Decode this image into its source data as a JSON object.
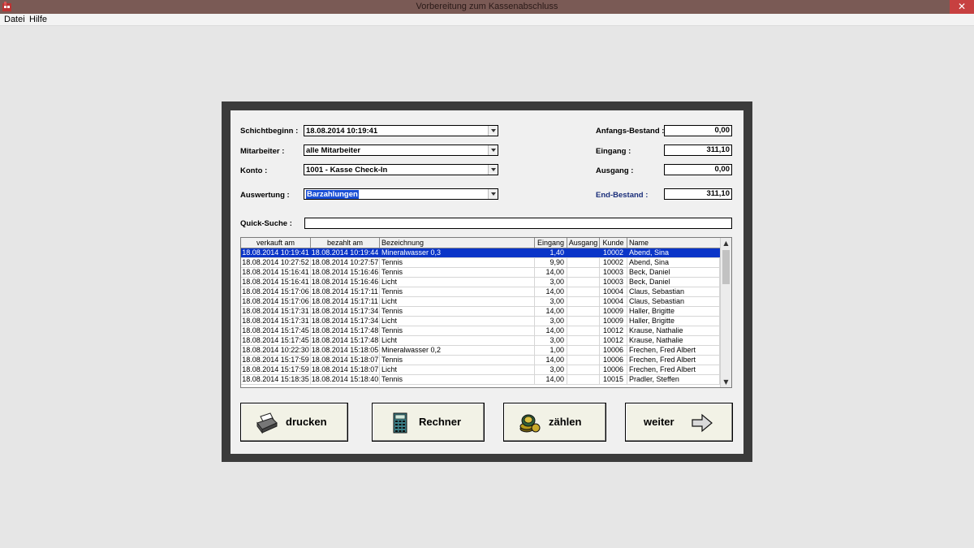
{
  "window": {
    "title": "Vorbereitung zum Kassenabschluss",
    "close_label": "✕"
  },
  "menu": [
    "Datei",
    "Hilfe"
  ],
  "form": {
    "schichtbeginn_label": "Schichtbeginn :",
    "schichtbeginn_value": "18.08.2014 10:19:41",
    "mitarbeiter_label": "Mitarbeiter :",
    "mitarbeiter_value": "alle Mitarbeiter",
    "konto_label": "Konto :",
    "konto_value": "1001 - Kasse Check-In",
    "auswertung_label": "Auswertung :",
    "auswertung_value": "Barzahlungen",
    "quick_label": "Quick-Suche :",
    "quick_value": ""
  },
  "totals": {
    "anfangs_label": "Anfangs-Bestand :",
    "anfangs_value": "0,00",
    "eingang_label": "Eingang :",
    "eingang_value": "311,10",
    "ausgang_label": "Ausgang :",
    "ausgang_value": "0,00",
    "end_label": "End-Bestand :",
    "end_value": "311,10",
    "end_label_color": "#1a2e7a"
  },
  "table": {
    "headers": [
      "verkauft am",
      "bezahlt am",
      "Bezeichnung",
      "Eingang",
      "Ausgang",
      "Kunde",
      "Name"
    ],
    "rows": [
      [
        "18.08.2014 10:19:41",
        "18.08.2014 10:19:44",
        "Mineralwasser 0,3",
        "1,40",
        "",
        "10002",
        "Abend, Sina"
      ],
      [
        "18.08.2014 10:27:52",
        "18.08.2014 10:27:57",
        "Tennis",
        "9,90",
        "",
        "10002",
        "Abend, Sina"
      ],
      [
        "18.08.2014 15:16:41",
        "18.08.2014 15:16:46",
        "Tennis",
        "14,00",
        "",
        "10003",
        "Beck, Daniel"
      ],
      [
        "18.08.2014 15:16:41",
        "18.08.2014 15:16:46",
        "Licht",
        "3,00",
        "",
        "10003",
        "Beck, Daniel"
      ],
      [
        "18.08.2014 15:17:06",
        "18.08.2014 15:17:11",
        "Tennis",
        "14,00",
        "",
        "10004",
        "Claus, Sebastian"
      ],
      [
        "18.08.2014 15:17:06",
        "18.08.2014 15:17:11",
        "Licht",
        "3,00",
        "",
        "10004",
        "Claus, Sebastian"
      ],
      [
        "18.08.2014 15:17:31",
        "18.08.2014 15:17:34",
        "Tennis",
        "14,00",
        "",
        "10009",
        "Haller, Brigitte"
      ],
      [
        "18.08.2014 15:17:31",
        "18.08.2014 15:17:34",
        "Licht",
        "3,00",
        "",
        "10009",
        "Haller, Brigitte"
      ],
      [
        "18.08.2014 15:17:45",
        "18.08.2014 15:17:48",
        "Tennis",
        "14,00",
        "",
        "10012",
        "Krause, Nathalie"
      ],
      [
        "18.08.2014 15:17:45",
        "18.08.2014 15:17:48",
        "Licht",
        "3,00",
        "",
        "10012",
        "Krause, Nathalie"
      ],
      [
        "18.08.2014 10:22:30",
        "18.08.2014 15:18:05",
        "Mineralwasser 0,2",
        "1,00",
        "",
        "10006",
        "Frechen, Fred Albert"
      ],
      [
        "18.08.2014 15:17:59",
        "18.08.2014 15:18:07",
        "Tennis",
        "14,00",
        "",
        "10006",
        "Frechen, Fred Albert"
      ],
      [
        "18.08.2014 15:17:59",
        "18.08.2014 15:18:07",
        "Licht",
        "3,00",
        "",
        "10006",
        "Frechen, Fred Albert"
      ],
      [
        "18.08.2014 15:18:35",
        "18.08.2014 15:18:40",
        "Tennis",
        "14,00",
        "",
        "10015",
        "Pradler, Steffen"
      ]
    ],
    "selected_row": 0
  },
  "buttons": {
    "print": "drucken",
    "calc": "Rechner",
    "count": "zählen",
    "next": "weiter"
  },
  "colors": {
    "selection": "#0a35c8",
    "frame": "#3b3b3b",
    "titlebar": "#7a5a55",
    "close": "#c74040"
  }
}
